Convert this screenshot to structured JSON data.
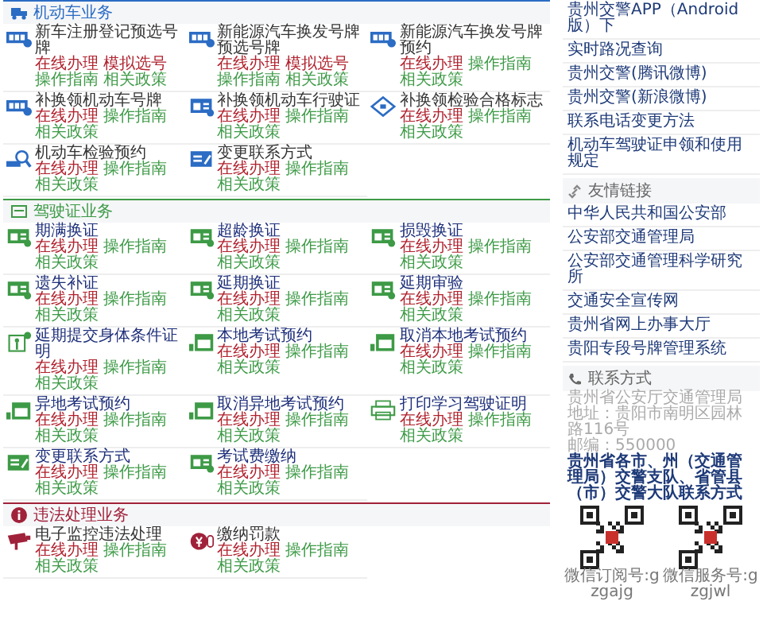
{
  "sections": [
    {
      "kind": "vehicle",
      "title": "机动车业务",
      "color": "#2b6cc4",
      "items": [
        {
          "title": "新车注册登记预选号牌",
          "links": [
            {
              "text": "在线办理",
              "color": "#b0222e"
            },
            {
              "text": "模拟选号",
              "color": "#b0222e"
            },
            {
              "text": "操作指南",
              "color": "#3d9a46"
            },
            {
              "text": "相关政策",
              "color": "#3d9a46"
            }
          ]
        },
        {
          "title": "新能源汽车换发号牌预选号牌",
          "links": [
            {
              "text": "在线办理",
              "color": "#b0222e"
            },
            {
              "text": "模拟选号",
              "color": "#b0222e"
            },
            {
              "text": "操作指南",
              "color": "#3d9a46"
            },
            {
              "text": "相关政策",
              "color": "#3d9a46"
            }
          ]
        },
        {
          "title": "新能源汽车换发号牌预约",
          "links": [
            {
              "text": "在线办理",
              "color": "#b0222e"
            },
            {
              "text": "操作指南",
              "color": "#3d9a46"
            },
            {
              "text": "相关政策",
              "color": "#3d9a46"
            }
          ]
        },
        {
          "title": "补换领机动车号牌",
          "links": [
            {
              "text": "在线办理",
              "color": "#b0222e"
            },
            {
              "text": "操作指南",
              "color": "#3d9a46"
            },
            {
              "text": "相关政策",
              "color": "#3d9a46"
            }
          ]
        },
        {
          "title": "补换领机动车行驶证",
          "links": [
            {
              "text": "在线办理",
              "color": "#b0222e"
            },
            {
              "text": "操作指南",
              "color": "#3d9a46"
            },
            {
              "text": "相关政策",
              "color": "#3d9a46"
            }
          ]
        },
        {
          "title": "补换领检验合格标志",
          "links": [
            {
              "text": "在线办理",
              "color": "#b0222e"
            },
            {
              "text": "操作指南",
              "color": "#3d9a46"
            },
            {
              "text": "相关政策",
              "color": "#3d9a46"
            }
          ]
        },
        {
          "title": "机动车检验预约",
          "links": [
            {
              "text": "在线办理",
              "color": "#b0222e"
            },
            {
              "text": "操作指南",
              "color": "#3d9a46"
            },
            {
              "text": "相关政策",
              "color": "#3d9a46"
            }
          ]
        },
        {
          "title": "变更联系方式",
          "links": [
            {
              "text": "在线办理",
              "color": "#b0222e"
            },
            {
              "text": "操作指南",
              "color": "#3d9a46"
            },
            {
              "text": "相关政策",
              "color": "#3d9a46"
            }
          ]
        }
      ]
    },
    {
      "kind": "license",
      "title": "驾驶证业务",
      "color": "#3d9a46",
      "items": [
        {
          "title": "期满换证",
          "links": [
            {
              "text": "在线办理",
              "color": "#b0222e"
            },
            {
              "text": "操作指南",
              "color": "#3d9a46"
            },
            {
              "text": "相关政策",
              "color": "#3d9a46"
            }
          ]
        },
        {
          "title": "超龄换证",
          "links": [
            {
              "text": "在线办理",
              "color": "#b0222e"
            },
            {
              "text": "操作指南",
              "color": "#3d9a46"
            },
            {
              "text": "相关政策",
              "color": "#3d9a46"
            }
          ]
        },
        {
          "title": "损毁换证",
          "links": [
            {
              "text": "在线办理",
              "color": "#b0222e"
            },
            {
              "text": "操作指南",
              "color": "#3d9a46"
            },
            {
              "text": "相关政策",
              "color": "#3d9a46"
            }
          ]
        },
        {
          "title": "遗失补证",
          "links": [
            {
              "text": "在线办理",
              "color": "#b0222e"
            },
            {
              "text": "操作指南",
              "color": "#3d9a46"
            },
            {
              "text": "相关政策",
              "color": "#3d9a46"
            }
          ]
        },
        {
          "title": "延期换证",
          "links": [
            {
              "text": "在线办理",
              "color": "#b0222e"
            },
            {
              "text": "操作指南",
              "color": "#3d9a46"
            },
            {
              "text": "相关政策",
              "color": "#3d9a46"
            }
          ]
        },
        {
          "title": "延期审验",
          "links": [
            {
              "text": "在线办理",
              "color": "#b0222e"
            },
            {
              "text": "操作指南",
              "color": "#3d9a46"
            },
            {
              "text": "相关政策",
              "color": "#3d9a46"
            }
          ]
        },
        {
          "title": "延期提交身体条件证明",
          "links": [
            {
              "text": "在线办理",
              "color": "#b0222e"
            },
            {
              "text": "操作指南",
              "color": "#3d9a46"
            },
            {
              "text": "相关政策",
              "color": "#3d9a46"
            }
          ]
        },
        {
          "title": "本地考试预约",
          "links": [
            {
              "text": "在线办理",
              "color": "#b0222e"
            },
            {
              "text": "操作指南",
              "color": "#3d9a46"
            },
            {
              "text": "相关政策",
              "color": "#3d9a46"
            }
          ]
        },
        {
          "title": "取消本地考试预约",
          "links": [
            {
              "text": "在线办理",
              "color": "#b0222e"
            },
            {
              "text": "操作指南",
              "color": "#3d9a46"
            },
            {
              "text": "相关政策",
              "color": "#3d9a46"
            }
          ]
        },
        {
          "title": "异地考试预约",
          "links": [
            {
              "text": "在线办理",
              "color": "#b0222e"
            },
            {
              "text": "操作指南",
              "color": "#3d9a46"
            },
            {
              "text": "相关政策",
              "color": "#3d9a46"
            }
          ]
        },
        {
          "title": "取消异地考试预约",
          "links": [
            {
              "text": "在线办理",
              "color": "#b0222e"
            },
            {
              "text": "操作指南",
              "color": "#3d9a46"
            },
            {
              "text": "相关政策",
              "color": "#3d9a46"
            }
          ]
        },
        {
          "title": "打印学习驾驶证明",
          "links": [
            {
              "text": "在线办理",
              "color": "#b0222e"
            },
            {
              "text": "操作指南",
              "color": "#3d9a46"
            },
            {
              "text": "相关政策",
              "color": "#3d9a46"
            }
          ]
        },
        {
          "title": "变更联系方式",
          "links": [
            {
              "text": "在线办理",
              "color": "#b0222e"
            },
            {
              "text": "操作指南",
              "color": "#3d9a46"
            },
            {
              "text": "相关政策",
              "color": "#3d9a46"
            }
          ]
        },
        {
          "title": "考试费缴纳",
          "links": [
            {
              "text": "在线办理",
              "color": "#b0222e"
            },
            {
              "text": "操作指南",
              "color": "#3d9a46"
            },
            {
              "text": "相关政策",
              "color": "#3d9a46"
            }
          ]
        }
      ]
    },
    {
      "kind": "violation",
      "title": "违法处理业务",
      "color": "#a0223a",
      "items": [
        {
          "title": "电子监控违法处理",
          "links": [
            {
              "text": "在线办理",
              "color": "#b0222e"
            },
            {
              "text": "操作指南",
              "color": "#3d9a46"
            },
            {
              "text": "相关政策",
              "color": "#3d9a46"
            }
          ]
        },
        {
          "title": "缴纳罚款",
          "links": [
            {
              "text": "在线办理",
              "color": "#b0222e"
            },
            {
              "text": "操作指南",
              "color": "#3d9a46"
            },
            {
              "text": "相关政策",
              "color": "#3d9a46"
            }
          ]
        }
      ]
    }
  ],
  "sidebar": {
    "top_links": [
      "贵州交警APP（Android版）下",
      "实时路况查询",
      "贵州交警(腾讯微博)",
      "贵州交警(新浪微博)",
      "联系电话变更方法",
      "机动车驾驶证申领和使用规定"
    ],
    "friend_links": {
      "title": "友情链接",
      "items": [
        "中华人民共和国公安部",
        "公安部交通管理局",
        "公安部交通管理科学研究所",
        "交通安全宣传网",
        "贵州省网上办事大厅",
        "贵阳专段号牌管理系统"
      ]
    },
    "contact": {
      "title": "联系方式",
      "lines": [
        "贵州省公安厅交通管理局",
        "地址：贵阳市南明区园林路116号",
        "邮编：550000"
      ],
      "link": "贵州省各市、州（交通管理局）交警支队、省管县（市）交警大队联系方式",
      "qr_codes": [
        {
          "caption": "微信订阅号:gzgajg"
        },
        {
          "caption": "微信服务号:gzgjwl"
        }
      ]
    }
  }
}
